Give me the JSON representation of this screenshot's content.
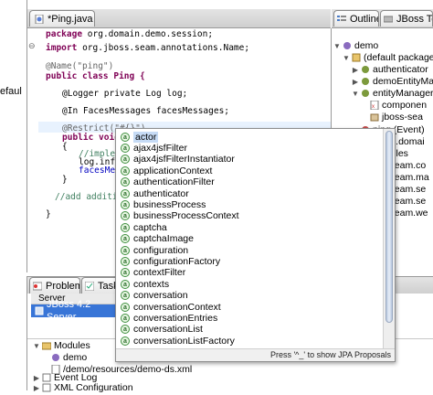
{
  "left_panel": {
    "truncated_text": "efaul"
  },
  "editor": {
    "tab_label": "*Ping.java",
    "lines": [
      "package org.domain.demo.session;",
      "import org.jboss.seam.annotations.Name;",
      "@Name(\"ping\")",
      "public class Ping {",
      "@Logger private Log log;",
      "@In FacesMessages facesMessages;",
      "@Restrict(\"#{}\")",
      "public void ping",
      "{",
      "//impleme",
      "log.info(",
      "facesMess",
      "}",
      "//add addition",
      "}"
    ]
  },
  "outline": {
    "tabs": [
      "Outline",
      "JBoss Too"
    ],
    "nodes": [
      "demo",
      "(default package)",
      "authenticator",
      "demoEntityMa",
      "entityManager",
      "componen",
      "jboss-sea",
      "ping (Event)",
      "org.domai",
      "curityRules",
      "JBoss.seam.co",
      "JBoss.seam.ma",
      "JBoss.seam.se",
      "JBoss.seam.se",
      "JBoss.seam.we"
    ]
  },
  "bottom": {
    "tabs": [
      "Problems",
      "Tasks"
    ],
    "server_header": "Server",
    "server_row": "JBoss 4.2 Server",
    "config_items": [
      "Modules",
      "demo",
      "/demo/resources/demo-ds.xml",
      "Event Log",
      "XML Configuration"
    ]
  },
  "autocomplete": {
    "items": [
      "actor",
      "ajax4jsfFilter",
      "ajax4jsfFilterInstantiator",
      "applicationContext",
      "authenticationFilter",
      "authenticator",
      "businessProcess",
      "businessProcessContext",
      "captcha",
      "captchaImage",
      "configuration",
      "configurationFactory",
      "contextFilter",
      "contexts",
      "conversation",
      "conversationContext",
      "conversationEntries",
      "conversationList",
      "conversationListFactory"
    ],
    "selected_index": 0,
    "footer": "Press '^_' to show JPA Proposals"
  },
  "colors": {
    "keyword": "#7f0055",
    "annotation": "#646464",
    "string": "#2a00ff",
    "comment": "#3f7f5f",
    "field": "#0000c0",
    "selection": "#3875d7"
  }
}
